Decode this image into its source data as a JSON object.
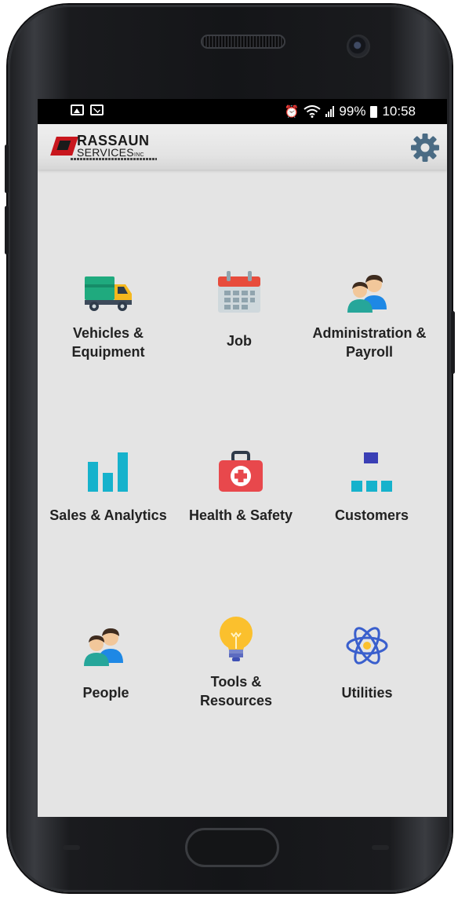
{
  "status_bar": {
    "battery_percent": "99%",
    "time": "10:58",
    "left_icons": [
      "image-icon",
      "mail-icon"
    ],
    "right_icons": [
      "alarm-icon",
      "wifi-icon",
      "signal-icon",
      "battery-icon"
    ]
  },
  "header": {
    "logo_title": "RASSAUN",
    "logo_subtitle": "SERVICES",
    "logo_suffix": "INC",
    "settings_icon": "gear-icon"
  },
  "colors": {
    "background": "#e4e4e4",
    "gear": "#4a6b84",
    "teal": "#16b2cc",
    "red": "#e8484c",
    "yellow": "#fbc02d",
    "blue": "#3a5fcd"
  },
  "tiles": [
    {
      "label": "Vehicles &\nEquipment",
      "icon": "truck-icon"
    },
    {
      "label": "Job",
      "icon": "calendar-icon"
    },
    {
      "label": "Administration &\nPayroll",
      "icon": "people-icon"
    },
    {
      "label": "Sales & Analytics",
      "icon": "bar-chart-icon"
    },
    {
      "label": "Health & Safety",
      "icon": "first-aid-icon"
    },
    {
      "label": "Customers",
      "icon": "org-chart-icon"
    },
    {
      "label": "People",
      "icon": "people-icon"
    },
    {
      "label": "Tools &\nResources",
      "icon": "lightbulb-icon"
    },
    {
      "label": "Utilities",
      "icon": "atom-icon"
    }
  ]
}
